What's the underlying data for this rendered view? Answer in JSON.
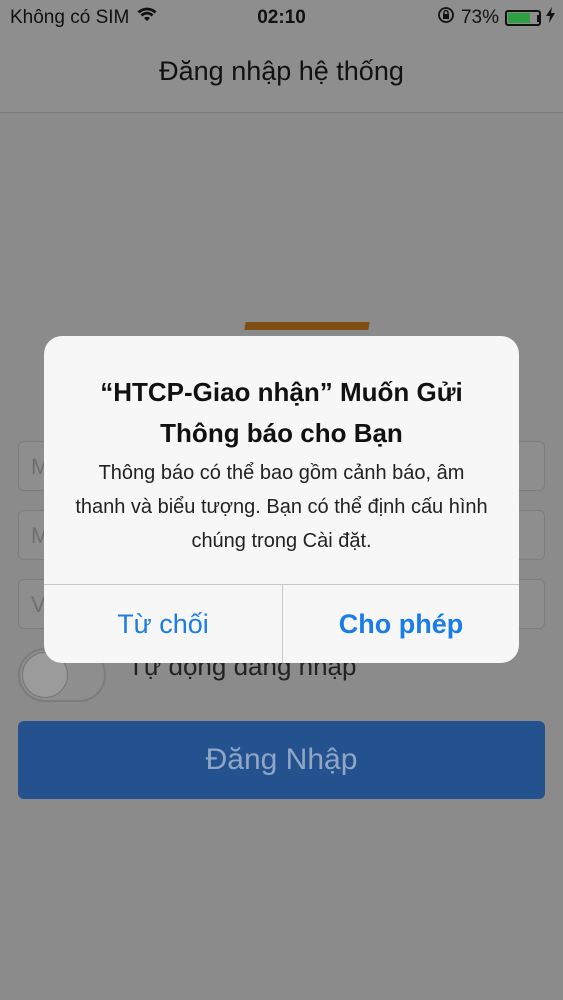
{
  "status_bar": {
    "carrier": "Không có SIM",
    "time": "02:10",
    "battery_percent": "73%",
    "battery_level": 0.73,
    "icons": [
      "wifi-icon",
      "rotation-lock-icon",
      "battery-icon",
      "charging-icon"
    ]
  },
  "nav": {
    "title": "Đăng nhập hệ thống"
  },
  "form": {
    "field1_placeholder": "M",
    "field2_placeholder": "M",
    "field3_placeholder": "V",
    "auto_login_label": "Tự động đăng nhập",
    "login_button": "Đăng Nhập"
  },
  "alert": {
    "title": "“HTCP-Giao nhận” Muốn Gửi Thông báo cho Bạn",
    "message": "Thông báo có thể bao gồm cảnh báo, âm thanh và biểu tượng. Bạn có thể định cấu hình chúng trong Cài đặt.",
    "deny_label": "Từ chối",
    "allow_label": "Cho phép"
  },
  "colors": {
    "accent": "#1a7ce6",
    "login_button_bg": "#23528f",
    "battery_green": "#2ea043"
  }
}
